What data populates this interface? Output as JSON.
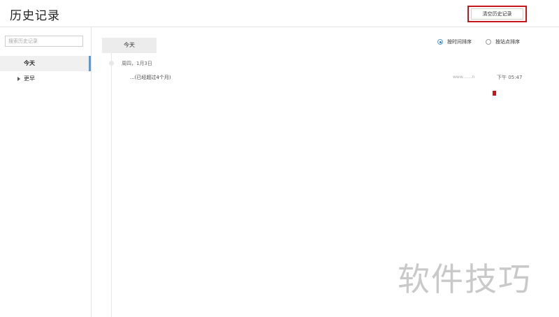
{
  "header": {
    "title": "历史记录",
    "clear_button_label": "清空历史记录"
  },
  "sidebar": {
    "search_placeholder": "搜索历史记录",
    "items": [
      {
        "label": "今天",
        "selected": true
      },
      {
        "label": "更早",
        "selected": false
      }
    ]
  },
  "main": {
    "today_tab_label": "今天",
    "date_label": "周四，1月3日",
    "sort_options": [
      {
        "label": "按时间排序",
        "checked": true
      },
      {
        "label": "按站点排序",
        "checked": false
      }
    ],
    "history_items": [
      {
        "title": "...(已经超过4个月)",
        "domain": "www.......n",
        "time": "下午 05:47"
      }
    ]
  },
  "watermark": "软件技巧",
  "colors": {
    "highlight_red": "#c8161d",
    "selected_blue": "#5b9bd5"
  }
}
